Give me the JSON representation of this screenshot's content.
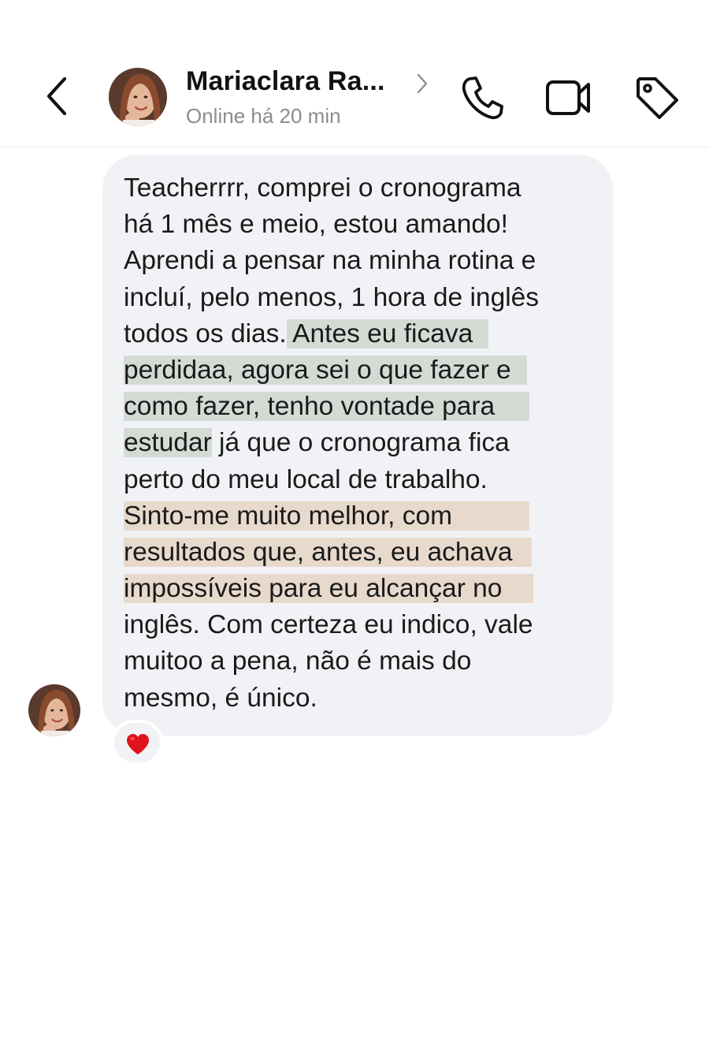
{
  "header": {
    "contact_name": "Mariaclara Ra...",
    "status": "Online há 20 min",
    "icons": {
      "back": "chevron-left-icon",
      "profile": "chevron-right-icon",
      "call": "phone-icon",
      "video": "video-camera-icon",
      "tag": "tag-icon"
    }
  },
  "message": {
    "lines": [
      {
        "segments": [
          "Teacherrrr, comprei o cronograma"
        ]
      },
      {
        "segments": [
          "há 1 mês e meio, estou amando!"
        ]
      },
      {
        "segments": [
          "Aprendi a pensar na minha rotina e"
        ]
      },
      {
        "segments": [
          "incluí, pelo menos, 1 hora de inglês"
        ]
      },
      {
        "segments": [
          "todos os dias.",
          " Antes eu ficava"
        ]
      },
      {
        "segments": [
          "perdidaa, agora sei o que fazer e"
        ]
      },
      {
        "segments": [
          "como fazer, tenho vontade para"
        ]
      },
      {
        "segments": [
          "estudar",
          " já que o cronograma fica"
        ]
      },
      {
        "segments": [
          "perto do meu local de trabalho."
        ]
      },
      {
        "segments": [
          "Sinto-me muito melhor, com"
        ]
      },
      {
        "segments": [
          "resultados que, antes, eu achava"
        ]
      },
      {
        "segments": [
          "impossíveis para eu alcançar no"
        ]
      },
      {
        "segments": [
          "inglês. Com certeza eu indico, vale"
        ]
      },
      {
        "segments": [
          "muitoo a pena, não é mais do"
        ]
      },
      {
        "segments": [
          "mesmo, é único."
        ]
      }
    ],
    "highlight_colors": {
      "green": "#d4dbd5",
      "peach": "#e8d9cd"
    },
    "bubble_color": "#f1f2f5",
    "reaction": "heart-icon",
    "reaction_color": "#e0141e"
  }
}
